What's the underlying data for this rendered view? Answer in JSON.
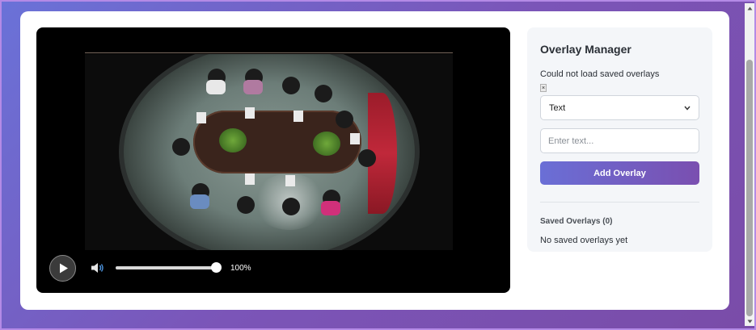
{
  "player": {
    "volume_percent": 100,
    "volume_label": "100%",
    "play_icon": "play-icon",
    "volume_icon": "volume-icon"
  },
  "manager": {
    "title": "Overlay Manager",
    "error": "Could not load saved overlays",
    "close_label": "×",
    "select_value": "Text",
    "input_placeholder": "Enter text...",
    "add_button": "Add Overlay",
    "saved_title": "Saved Overlays (0)",
    "saved_empty": "No saved overlays yet"
  },
  "colors": {
    "accent_start": "#6a6fd6",
    "accent_end": "#7a4fb0"
  }
}
